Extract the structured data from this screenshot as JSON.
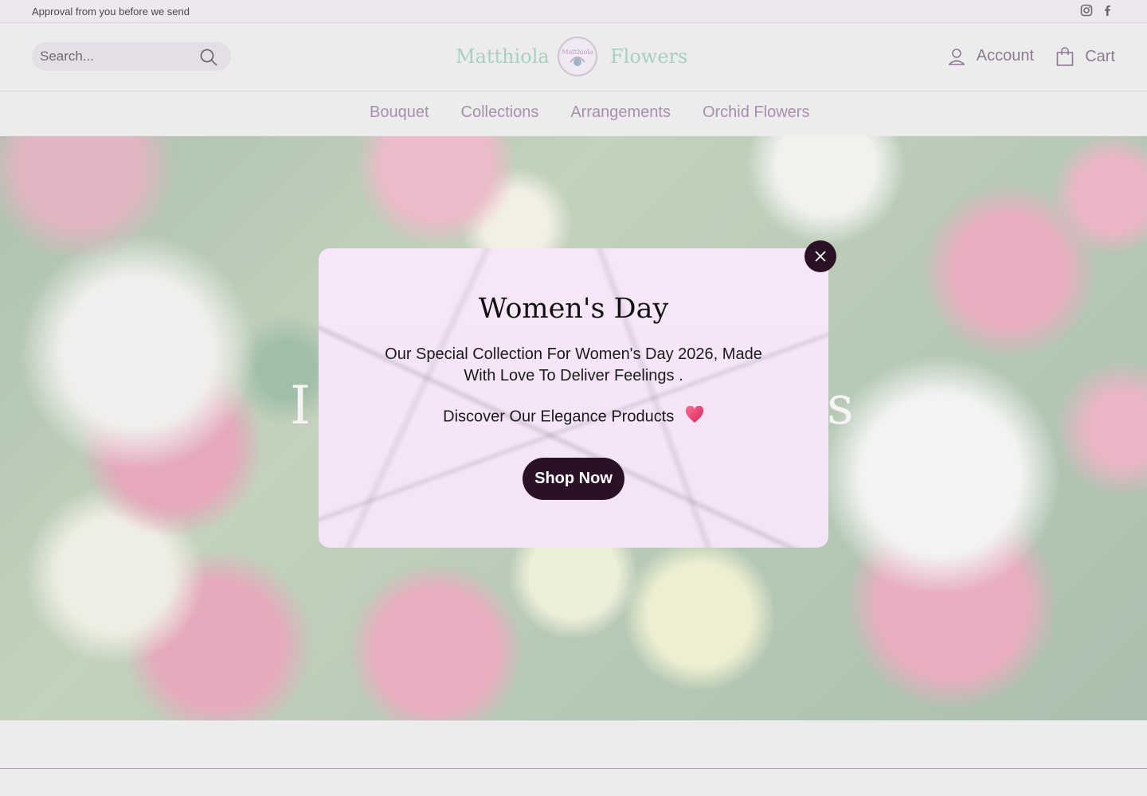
{
  "announcement": {
    "text": "Approval from you before we send"
  },
  "social": {
    "icons": [
      "instagram-icon",
      "facebook-icon"
    ]
  },
  "header": {
    "search_placeholder": "Search...",
    "logo": {
      "word1": "Matthiola",
      "word2": "Flowers",
      "badge_text": "Matthiola"
    },
    "account_label": "Account",
    "cart_label": "Cart"
  },
  "nav": {
    "items": [
      "Bouquet",
      "Collections",
      "Arrangements",
      "Orchid Flowers"
    ]
  },
  "hero": {
    "title_left": "I",
    "title_right": "s"
  },
  "popup": {
    "title": "Women's Day",
    "description": "Our Special Collection For Women's Day 2026, Made With Love To Deliver Feelings .",
    "discover": "Discover Our Elegance Products",
    "button_label": "Shop Now"
  },
  "colors": {
    "accent": "#2b1128",
    "nav_text": "#a78fad",
    "logo_text": "#a7cfc6",
    "popup_bg": "#f6e6f8"
  }
}
